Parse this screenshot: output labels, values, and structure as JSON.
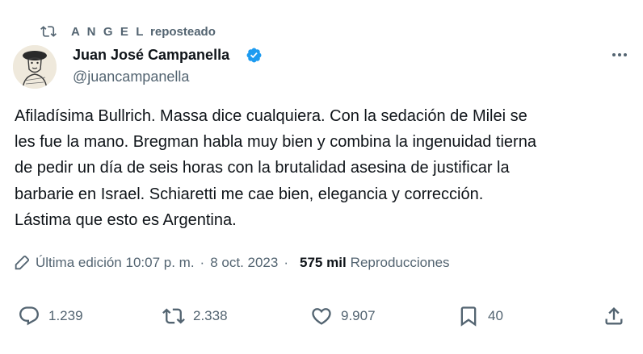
{
  "repost": {
    "user": "A N G E L",
    "label": "reposteado",
    "icon": "repost-icon"
  },
  "author": {
    "name": "Juan José Campanella",
    "handle": "@juancampanella",
    "verified_color": "#1d9bf0"
  },
  "tweet": {
    "lines": [
      "Afiladísima Bullrich. Massa dice cualquiera. Con la sedación de Milei se",
      "les fue la mano. Bregman habla muy bien y combina la ingenuidad tierna",
      "de pedir un día de seis horas con la brutalidad asesina de justificar la",
      "barbarie en Israel. Schiaretti me cae bien, elegancia y corrección.",
      "Lástima que esto es Argentina."
    ]
  },
  "meta": {
    "edited": "Última edición 10:07 p. m.",
    "separator": "·",
    "date": "8 oct. 2023",
    "views": "575 mil",
    "views_label": "Reproducciones"
  },
  "actions": {
    "replies": "1.239",
    "reposts": "2.338",
    "likes": "9.907",
    "bookmarks": "40"
  },
  "colors": {
    "text": "#0f1419",
    "secondary": "#536471",
    "accent": "#1d9bf0"
  }
}
